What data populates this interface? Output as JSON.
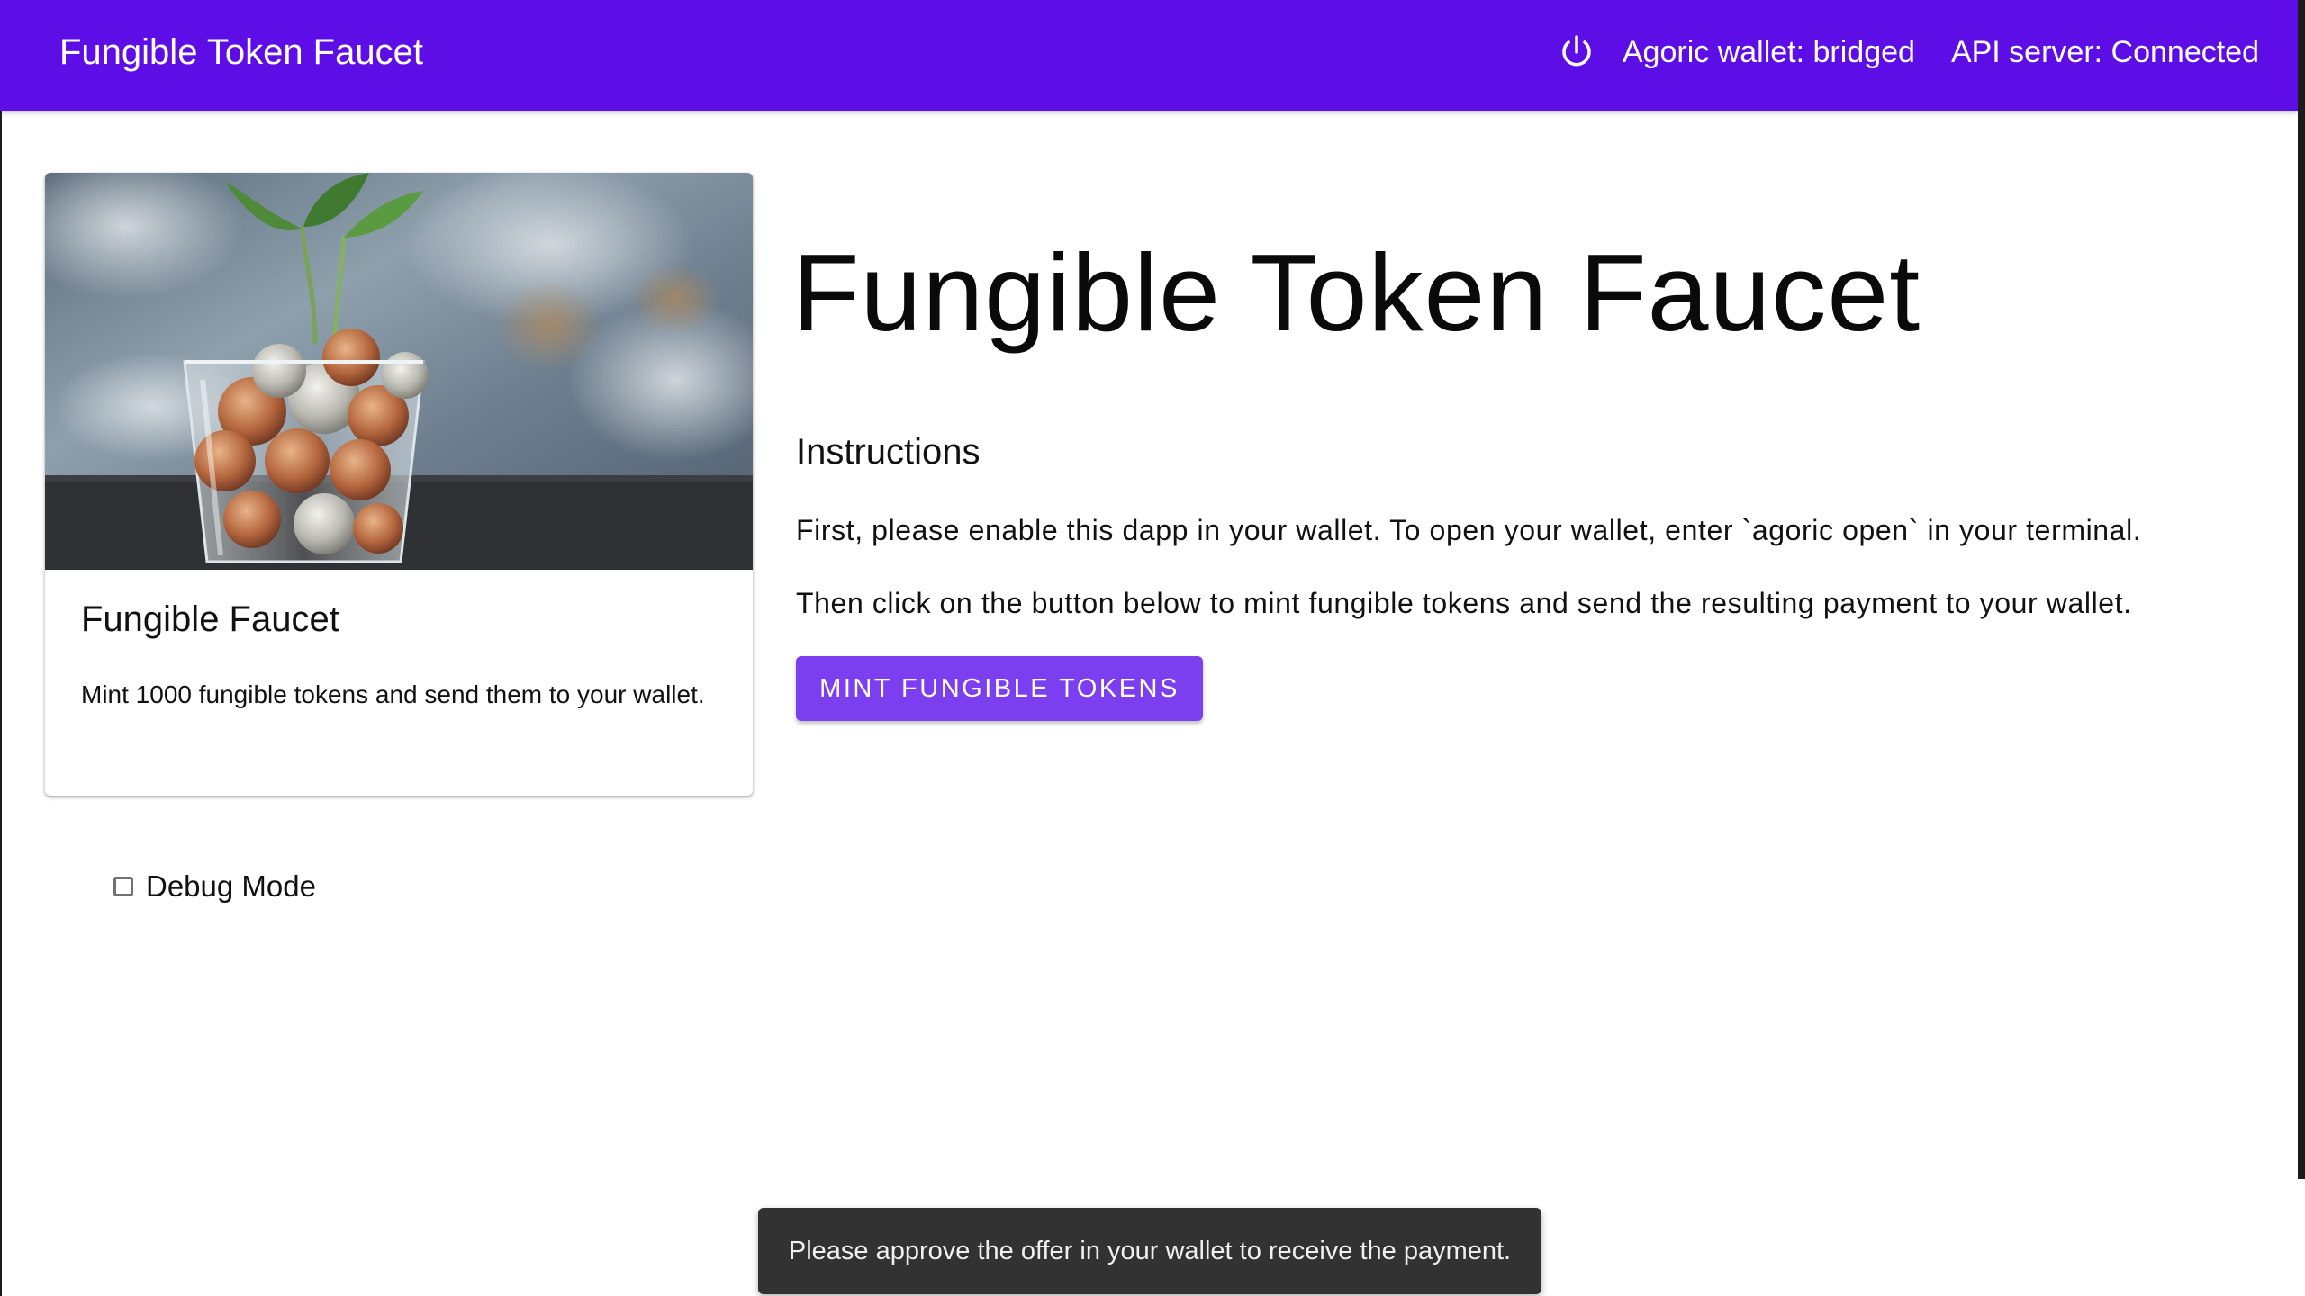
{
  "appbar": {
    "title": "Fungible Token Faucet",
    "power_icon": "power-icon",
    "wallet_status": "Agoric wallet: bridged",
    "api_status": "API server: Connected",
    "color": "#5d0ee6"
  },
  "card": {
    "title": "Fungible Faucet",
    "description": "Mint 1000 fungible tokens and send them to your wallet.",
    "image": "coins-in-glass-with-sprout"
  },
  "debug": {
    "label": "Debug Mode",
    "checked": false
  },
  "main": {
    "headline": "Fungible Token Faucet",
    "instructions_heading": "Instructions",
    "paragraph1": "First, please enable this dapp in your wallet. To open your wallet, enter `agoric open` in your terminal.",
    "paragraph2": "Then click on the button below to mint fungible tokens and send the resulting payment to your wallet.",
    "mint_button_label": "MINT FUNGIBLE TOKENS",
    "button_color": "#7c3ff0"
  },
  "snackbar": {
    "message": "Please approve the offer in your wallet to receive the payment."
  }
}
